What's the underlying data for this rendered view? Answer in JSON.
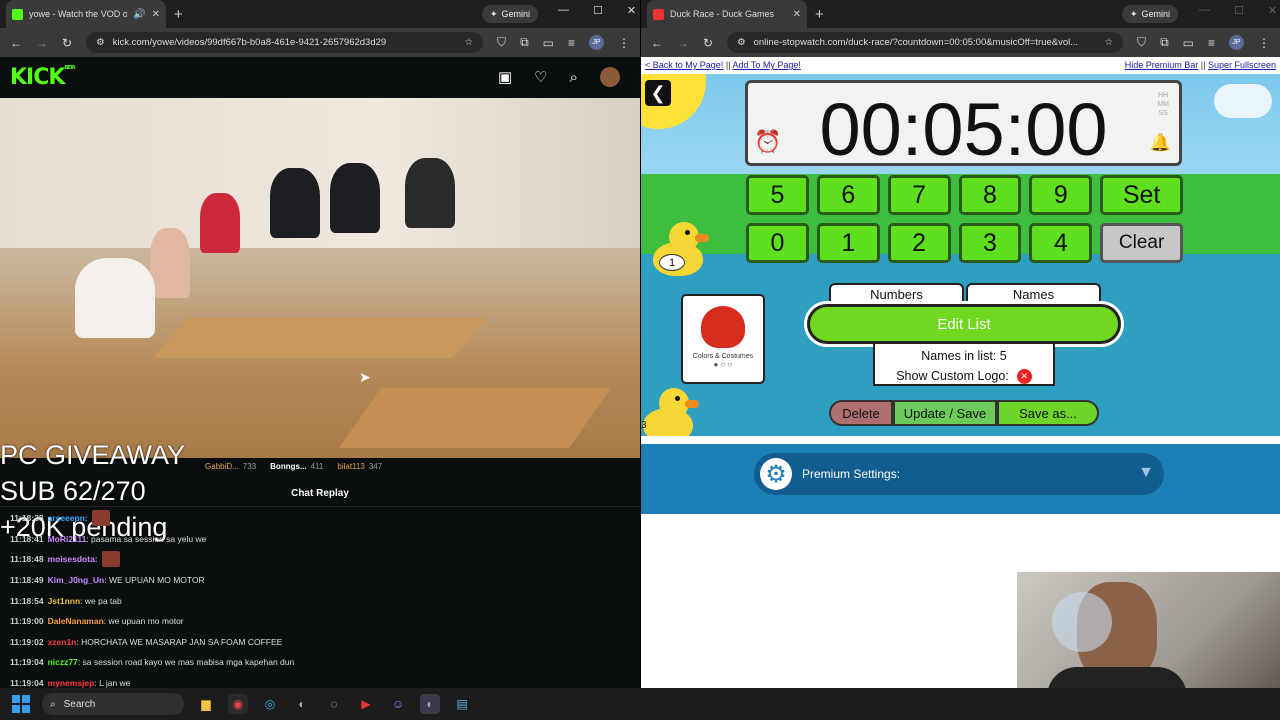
{
  "left_browser": {
    "tab_title": "yowe - Watch the VOD on K",
    "gemini_label": "Gemini",
    "url": "kick.com/yowe/videos/99df667b-b0a8-461e-9421-2657962d3d29",
    "profile_initials": "JP"
  },
  "kick": {
    "logo": "KICK",
    "logo_badge": "BETA",
    "overlay_lines": [
      "PC GIVEAWAY",
      "SUB 62/270",
      "+20K pending"
    ],
    "leaderboard": [
      {
        "name": "GabbiD...",
        "count": "733"
      },
      {
        "name": "Bonngs...",
        "count": "411"
      },
      {
        "name": "bilat113",
        "count": "347"
      }
    ],
    "chat_header": "Chat Replay",
    "messages": [
      {
        "ts": "11:18:38",
        "user": "arseeepn:",
        "text": "",
        "color": "#3aa7ff",
        "emote": true
      },
      {
        "ts": "11:18:41",
        "user": "MoRi2111",
        "text": ": pasama sa session sa yelu we",
        "color": "#c98bff",
        "emote": false
      },
      {
        "ts": "11:18:48",
        "user": "moisesdota:",
        "text": "",
        "color": "#c98bff",
        "emote": true
      },
      {
        "ts": "11:18:49",
        "user": "Kim_J0ng_Un",
        "text": ": WE UPUAN MO MOTOR",
        "color": "#c98bff",
        "emote": false
      },
      {
        "ts": "11:18:54",
        "user": "Jst1nnn",
        "text": ": we pa tab",
        "color": "#f0c040",
        "emote": false
      },
      {
        "ts": "11:19:00",
        "user": "DaleNanaman",
        "text": ": we upuan mo motor",
        "color": "#f0a040",
        "emote": false
      },
      {
        "ts": "11:19:02",
        "user": "xzen1n",
        "text": ": HORCHATA WE MASARAP JAN SA FOAM COFFEE",
        "color": "#ff3a3a",
        "emote": false
      },
      {
        "ts": "11:19:04",
        "user": "niczz77",
        "text": ": sa session road kayo we mas mabisa mga kapehan dun",
        "color": "#53fc18",
        "emote": false
      },
      {
        "ts": "11:19:04",
        "user": "mynemsjep",
        "text": ": L jan we",
        "color": "#ff3a3a",
        "emote": false
      }
    ]
  },
  "right_browser": {
    "tab_title": "Duck Race - Duck Games",
    "gemini_label": "Gemini",
    "url": "online-stopwatch.com/duck-race/?countdown=00:05:00&musicOff=true&vol...",
    "profile_initials": "JP"
  },
  "duck_race": {
    "links_left": [
      "< Back to My Page!",
      "||",
      "Add To My Page!"
    ],
    "links_right": [
      "Hide Premium Bar",
      "||",
      "Super Fullscreen"
    ],
    "timer": "00:05:00",
    "hms": [
      "HH",
      "MM",
      "SS"
    ],
    "keys_row1": [
      "5",
      "6",
      "7",
      "8",
      "9"
    ],
    "keys_row2": [
      "0",
      "1",
      "2",
      "3",
      "4"
    ],
    "set_label": "Set",
    "clear_label": "Clear",
    "duck1_number": "1",
    "duck3_number": "3",
    "logo_caption": "Colors & Costumes",
    "tab_numbers": "Numbers",
    "tab_names": "Names",
    "edit_list": "Edit List",
    "names_in_list": "Names in list: 5",
    "show_custom_logo": "Show Custom Logo:",
    "delete": "Delete",
    "update_save": "Update / Save",
    "save_as": "Save as...",
    "premium": "Premium Settings:"
  },
  "taskbar": {
    "search": "Search"
  }
}
